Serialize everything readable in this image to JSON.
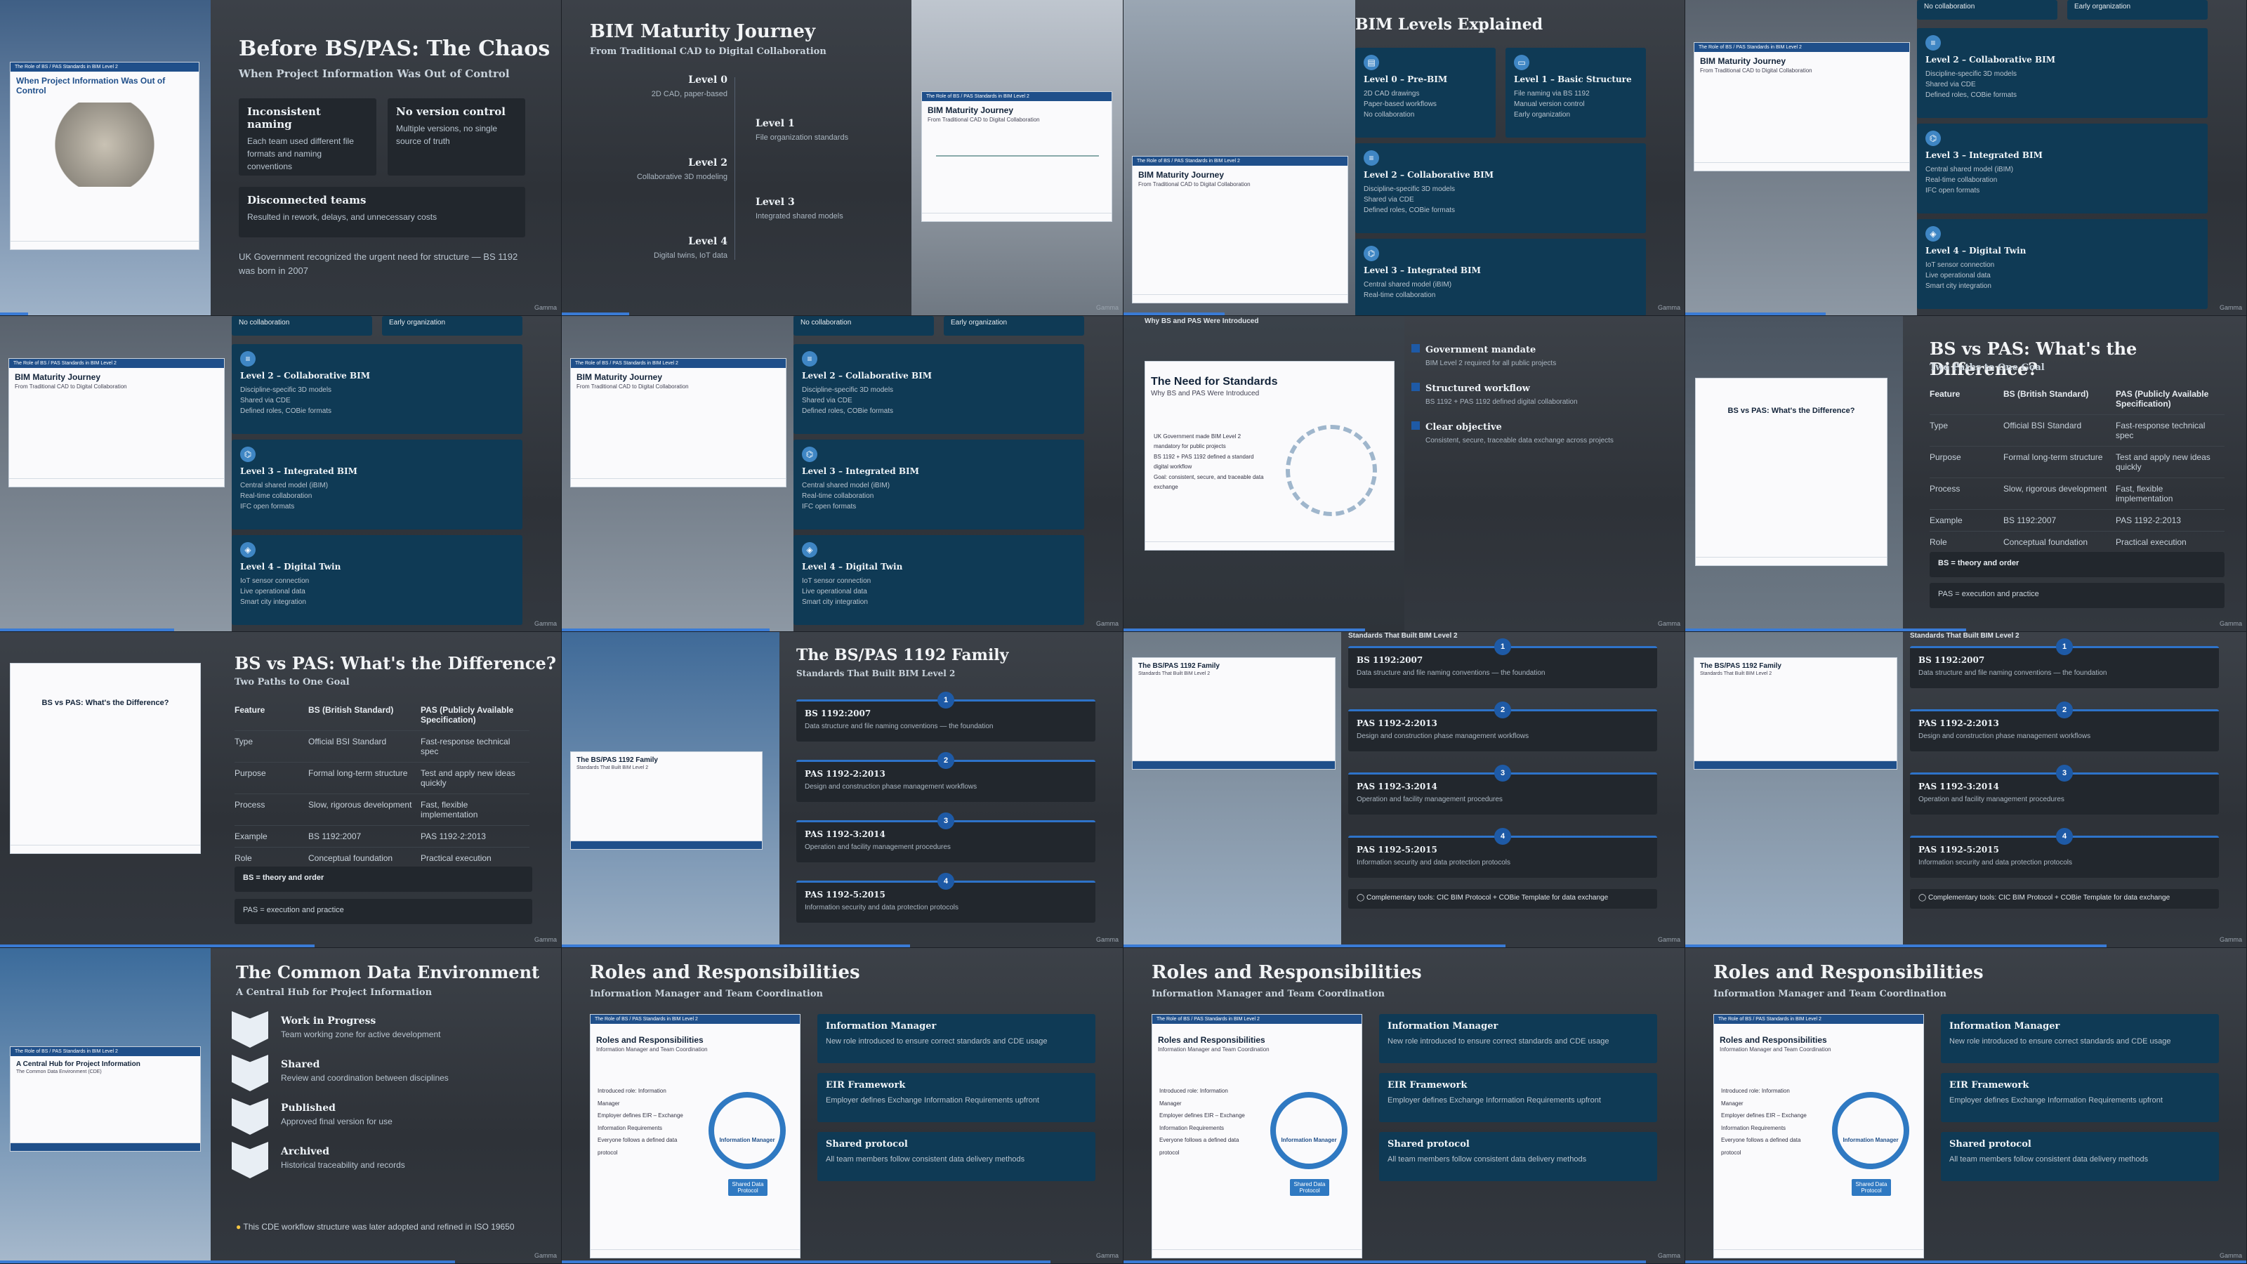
{
  "footer": {
    "brand": "Gamma"
  },
  "thumb_header": "The Role of BS / PAS Standards in BIM Level 2",
  "t1": {
    "title": "Before BS/PAS: The Chaos",
    "subtitle": "When Project Information Was Out of Control",
    "thumb_title": "When Project Information Was Out of Control",
    "cards": [
      {
        "title": "Inconsistent naming",
        "body": "Each team used different file formats and naming conventions"
      },
      {
        "title": "No version control",
        "body": "Multiple versions, no single source of truth"
      },
      {
        "title": "Disconnected teams",
        "body": "Resulted in rework, delays, and unnecessary costs"
      }
    ],
    "note": "UK Government recognized the urgent need for structure — BS 1192 was born in 2007"
  },
  "t2": {
    "title": "BIM Maturity Journey",
    "subtitle": "From Traditional CAD to Digital Collaboration",
    "levels": [
      {
        "name": "Level 0",
        "desc": "2D CAD, paper-based"
      },
      {
        "name": "Level 1",
        "desc": "File organization standards"
      },
      {
        "name": "Level 2",
        "desc": "Collaborative 3D modeling"
      },
      {
        "name": "Level 3",
        "desc": "Integrated shared models"
      },
      {
        "name": "Level 4",
        "desc": "Digital twins, IoT data"
      }
    ],
    "thumb_title": "BIM Maturity Journey",
    "thumb_sub": "From Traditional CAD to Digital Collaboration"
  },
  "t3": {
    "title": "BIM Levels Explained",
    "cards": [
      {
        "title": "Level 0 – Pre-BIM",
        "lines": [
          "2D CAD drawings",
          "Paper-based workflows",
          "No collaboration"
        ]
      },
      {
        "title": "Level 1 – Basic Structure",
        "lines": [
          "File naming via BS 1192",
          "Manual version control",
          "Early organization"
        ]
      },
      {
        "title": "Level 2 – Collaborative BIM",
        "lines": [
          "Discipline-specific 3D models",
          "Shared via CDE",
          "Defined roles, COBie formats"
        ]
      },
      {
        "title": "Level 3 – Integrated BIM",
        "lines": [
          "Central shared model (iBIM)",
          "Real-time collaboration"
        ]
      }
    ]
  },
  "t4": {
    "top_cards": [
      "No collaboration",
      "Early organization"
    ],
    "cards": [
      {
        "title": "Level 2 – Collaborative BIM",
        "lines": [
          "Discipline-specific 3D models",
          "Shared via CDE",
          "Defined roles, COBie formats"
        ]
      },
      {
        "title": "Level 3 – Integrated BIM",
        "lines": [
          "Central shared model (iBIM)",
          "Real-time collaboration",
          "IFC open formats"
        ]
      },
      {
        "title": "Level 4 – Digital Twin",
        "lines": [
          "IoT sensor connection",
          "Live operational data",
          "Smart city integration"
        ]
      }
    ]
  },
  "t7": {
    "kicker": "Why BS and PAS Were Introduced",
    "thumb_title": "The Need for Standards",
    "thumb_sub": "Why BS and PAS Were Introduced",
    "thumb_items": [
      "UK Government made BIM Level 2 mandatory for public projects",
      "BS 1192 + PAS 1192 defined a standard digital workflow",
      "Goal: consistent, secure, and traceable data exchange"
    ],
    "items": [
      {
        "title": "Government mandate",
        "body": "BIM Level 2 required for all public projects"
      },
      {
        "title": "Structured workflow",
        "body": "BS 1192 + PAS 1192 defined digital collaboration"
      },
      {
        "title": "Clear objective",
        "body": "Consistent, secure, traceable data exchange across projects"
      }
    ]
  },
  "t8": {
    "title": "BS vs PAS: What's the Difference?",
    "subtitle": "Two Paths to One Goal",
    "headers": [
      "Feature",
      "BS (British Standard)",
      "PAS (Publicly Available Specification)"
    ],
    "rows": [
      [
        "Type",
        "Official BSI Standard",
        "Fast-response technical spec"
      ],
      [
        "Purpose",
        "Formal long-term structure",
        "Test and apply new ideas quickly"
      ],
      [
        "Process",
        "Slow, rigorous development",
        "Fast, flexible implementation"
      ],
      [
        "Example",
        "BS 1192:2007",
        "PAS 1192-2:2013"
      ],
      [
        "Role",
        "Conceptual foundation",
        "Practical execution"
      ]
    ],
    "notes": [
      "BS = theory and order",
      "PAS = execution and practice"
    ]
  },
  "t10": {
    "title": "The BS/PAS 1192 Family",
    "subtitle": "Standards That Built BIM Level 2",
    "items": [
      {
        "num": "1",
        "title": "BS 1192:2007",
        "body": "Data structure and file naming conventions — the foundation"
      },
      {
        "num": "2",
        "title": "PAS 1192-2:2013",
        "body": "Design and construction phase management workflows"
      },
      {
        "num": "3",
        "title": "PAS 1192-3:2014",
        "body": "Operation and facility management procedures"
      },
      {
        "num": "4",
        "title": "PAS 1192-5:2015",
        "body": "Information security and data protection protocols"
      }
    ],
    "tools": "Complementary tools: CIC BIM Protocol + COBie Template for data exchange"
  },
  "t13": {
    "title": "The Common Data Environment",
    "subtitle": "A Central Hub for Project Information",
    "thumb_title": "A Central Hub for Project Information",
    "thumb_sub": "The Common Data Environment (CDE)",
    "stages": [
      {
        "title": "Work in Progress",
        "body": "Team working zone for active development"
      },
      {
        "title": "Shared",
        "body": "Review and coordination between disciplines"
      },
      {
        "title": "Published",
        "body": "Approved final version for use"
      },
      {
        "title": "Archived",
        "body": "Historical traceability and records"
      }
    ],
    "note": "This CDE workflow structure was later adopted and refined in ISO 19650"
  },
  "t14": {
    "title": "Roles and Responsibilities",
    "subtitle": "Information Manager and Team Coordination",
    "thumb_title": "Roles and Responsibilities",
    "thumb_sub": "Information Manager and Team Coordination",
    "thumb_items": [
      "Introduced role: Information Manager",
      "Employer defines EIR – Exchange Information Requirements",
      "Everyone follows a defined data protocol"
    ],
    "thumb_center": "Information Manager",
    "thumb_badge": "Shared Data Protocol",
    "cards": [
      {
        "title": "Information Manager",
        "body": "New role introduced to ensure correct standards and CDE usage"
      },
      {
        "title": "EIR Framework",
        "body": "Employer defines Exchange Information Requirements upfront"
      },
      {
        "title": "Shared protocol",
        "body": "All team members follow consistent data delivery methods"
      }
    ]
  },
  "progress": [
    0.05,
    0.12,
    0.18,
    0.25,
    0.31,
    0.37,
    0.43,
    0.5,
    0.56,
    0.62,
    0.68,
    0.75,
    0.81,
    0.87,
    0.93,
    1.0
  ]
}
